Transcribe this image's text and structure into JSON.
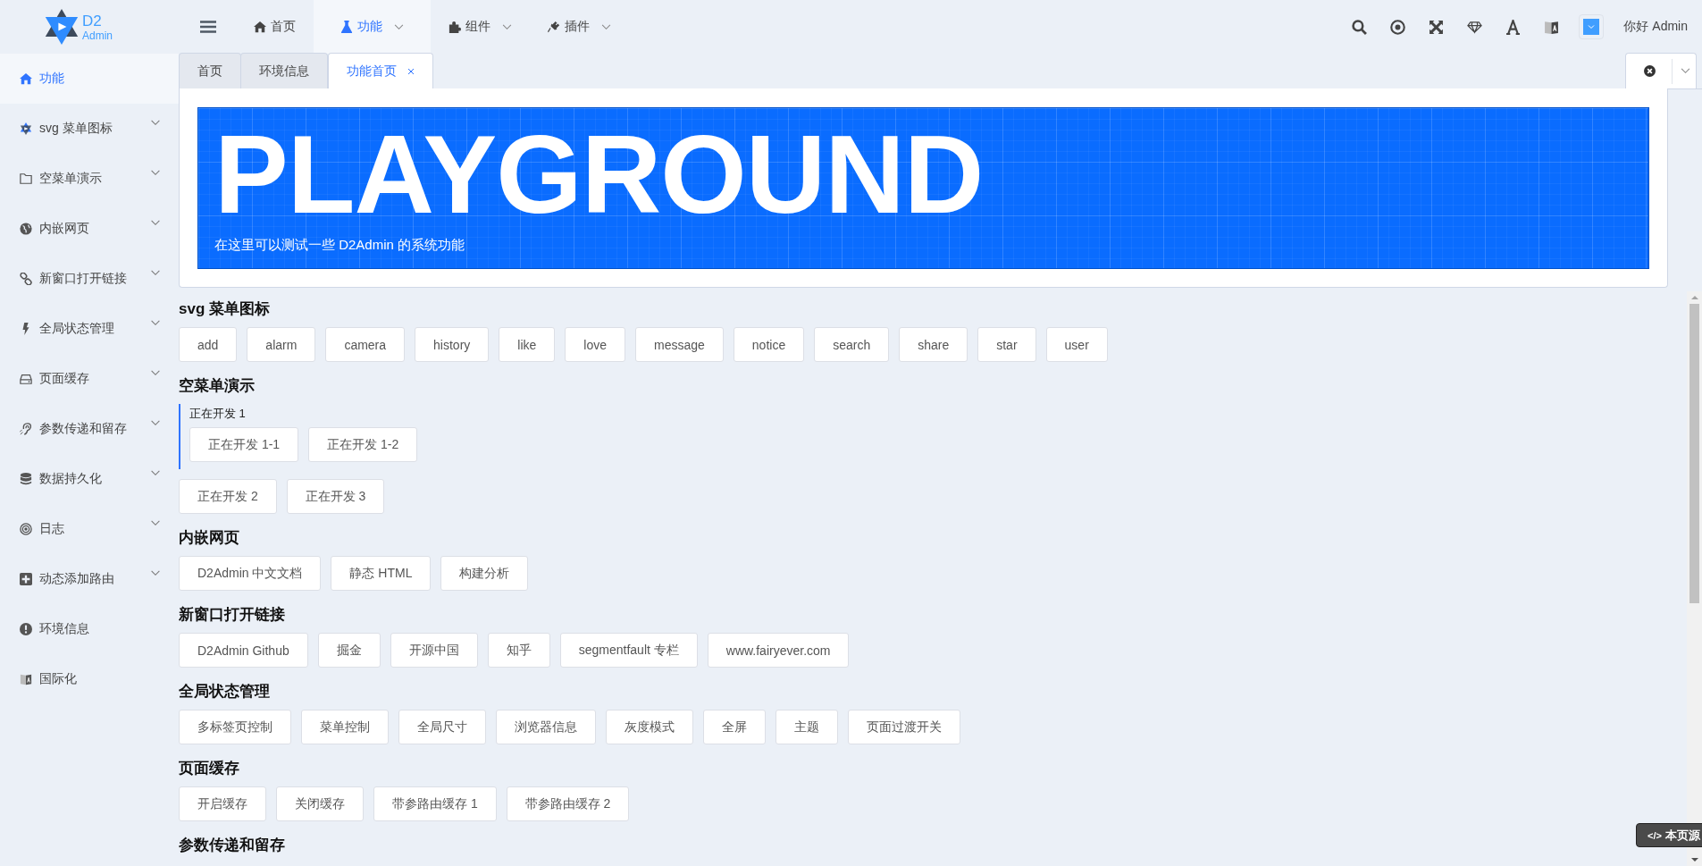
{
  "logo": {
    "title": "D2",
    "subtitle": "Admin"
  },
  "top_nav": [
    {
      "label": "首页",
      "selected": false,
      "dropdown": false
    },
    {
      "label": "功能",
      "selected": true,
      "dropdown": true
    },
    {
      "label": "组件",
      "selected": false,
      "dropdown": true
    },
    {
      "label": "插件",
      "selected": false,
      "dropdown": true
    }
  ],
  "greeting": "你好 Admin",
  "sidebar": {
    "items": [
      {
        "label": "功能",
        "selected": true,
        "expandable": false
      },
      {
        "label": "svg 菜单图标",
        "selected": false,
        "expandable": true
      },
      {
        "label": "空菜单演示",
        "selected": false,
        "expandable": true
      },
      {
        "label": "内嵌网页",
        "selected": false,
        "expandable": true
      },
      {
        "label": "新窗口打开链接",
        "selected": false,
        "expandable": true
      },
      {
        "label": "全局状态管理",
        "selected": false,
        "expandable": true
      },
      {
        "label": "页面缓存",
        "selected": false,
        "expandable": true
      },
      {
        "label": "参数传递和留存",
        "selected": false,
        "expandable": true
      },
      {
        "label": "数据持久化",
        "selected": false,
        "expandable": true
      },
      {
        "label": "日志",
        "selected": false,
        "expandable": true
      },
      {
        "label": "动态添加路由",
        "selected": false,
        "expandable": true
      },
      {
        "label": "环境信息",
        "selected": false,
        "expandable": false
      },
      {
        "label": "国际化",
        "selected": false,
        "expandable": false
      }
    ]
  },
  "tabs": [
    {
      "label": "首页",
      "selected": false,
      "closable": false
    },
    {
      "label": "环境信息",
      "selected": false,
      "closable": false
    },
    {
      "label": "功能首页",
      "selected": true,
      "closable": true
    }
  ],
  "banner": {
    "title": "PLAYGROUND",
    "subtitle": "在这里可以测试一些 D2Admin 的系统功能"
  },
  "sections": [
    {
      "title": "svg 菜单图标",
      "items": [
        {
          "label": "add"
        },
        {
          "label": "alarm"
        },
        {
          "label": "camera"
        },
        {
          "label": "history"
        },
        {
          "label": "like"
        },
        {
          "label": "love"
        },
        {
          "label": "message"
        },
        {
          "label": "notice"
        },
        {
          "label": "search"
        },
        {
          "label": "share"
        },
        {
          "label": "star"
        },
        {
          "label": "user"
        }
      ]
    },
    {
      "title": "空菜单演示",
      "items": [
        {
          "kind": "group",
          "label": "正在开发 1",
          "children": [
            {
              "label": "正在开发 1-1"
            },
            {
              "label": "正在开发 1-2"
            }
          ]
        },
        {
          "label": "正在开发 2"
        },
        {
          "label": "正在开发 3"
        }
      ]
    },
    {
      "title": "内嵌网页",
      "items": [
        {
          "label": "D2Admin 中文文档"
        },
        {
          "label": "静态 HTML"
        },
        {
          "label": "构建分析"
        }
      ]
    },
    {
      "title": "新窗口打开链接",
      "items": [
        {
          "label": "D2Admin Github"
        },
        {
          "label": "掘金"
        },
        {
          "label": "开源中国"
        },
        {
          "label": "知乎"
        },
        {
          "label": "segmentfault 专栏"
        },
        {
          "label": "www.fairyever.com"
        }
      ]
    },
    {
      "title": "全局状态管理",
      "items": [
        {
          "label": "多标签页控制"
        },
        {
          "label": "菜单控制"
        },
        {
          "label": "全局尺寸"
        },
        {
          "label": "浏览器信息"
        },
        {
          "label": "灰度模式"
        },
        {
          "label": "全屏"
        },
        {
          "label": "主题"
        },
        {
          "label": "页面过渡开关"
        }
      ]
    },
    {
      "title": "页面缓存",
      "items": [
        {
          "label": "开启缓存"
        },
        {
          "label": "关闭缓存"
        },
        {
          "label": "带参路由缓存 1"
        },
        {
          "label": "带参路由缓存 2"
        }
      ]
    },
    {
      "title": "参数传递和留存"
    }
  ],
  "source_button": {
    "icon_text": "</>",
    "label": "本页源"
  }
}
